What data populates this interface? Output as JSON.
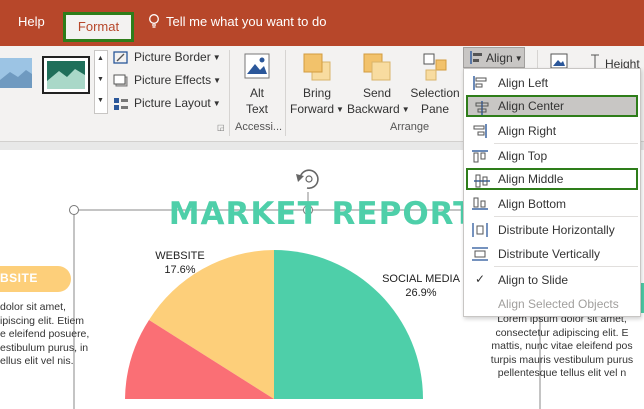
{
  "tabs": {
    "help": "Help",
    "format": "Format",
    "tell_me": "Tell me what you want to do"
  },
  "ribbon": {
    "picture_border": "Picture Border",
    "picture_effects": "Picture Effects",
    "picture_layout": "Picture Layout",
    "alt_text_1": "Alt",
    "alt_text_2": "Text",
    "accessibility_group": "Accessi...",
    "bring_forward_1": "Bring",
    "bring_forward_2": "Forward",
    "send_backward_1": "Send",
    "send_backward_2": "Backward",
    "selection_pane_1": "Selection",
    "selection_pane_2": "Pane",
    "arrange_group": "Arrange",
    "align_button": "Align",
    "height_label": "Height"
  },
  "align_menu": {
    "items": [
      {
        "label": "Align Left",
        "icon": "align-left-icon"
      },
      {
        "label": "Align Center",
        "icon": "align-center-icon",
        "state": "highlighted"
      },
      {
        "label": "Align Right",
        "icon": "align-right-icon"
      },
      {
        "label": "Align Top",
        "icon": "align-top-icon"
      },
      {
        "label": "Align Middle",
        "icon": "align-middle-icon",
        "state": "outlined"
      },
      {
        "label": "Align Bottom",
        "icon": "align-bottom-icon"
      },
      {
        "label": "Distribute Horizontally",
        "icon": "distribute-horizontally-icon"
      },
      {
        "label": "Distribute Vertically",
        "icon": "distribute-vertically-icon"
      },
      {
        "label": "Align to Slide",
        "icon": "checkmark-icon",
        "checked": true
      },
      {
        "label": "Align Selected Objects",
        "disabled": true
      }
    ]
  },
  "slide": {
    "title": "MARKET REPORT",
    "website_label": "WEBSITE",
    "website_pct": "17.6%",
    "social_label": "SOCIAL MEDIA",
    "social_pct": "26.9%",
    "badge_text": "BSITE",
    "left_text": [
      "dolor sit amet,",
      "ipiscing elit. Etiem",
      "e eleifend posuere,",
      "estibulum purus, in",
      "ellus elit vel nis."
    ],
    "right_text": [
      "Lorem ipsum dolor sit amet,",
      "consectetur adipiscing elit. E",
      "mattis, nunc vitae eleifend pos",
      "turpis mauris vestibulum purus",
      "pellentesque tellus elit vel n"
    ]
  },
  "colors": {
    "ribbon_red": "#b7472a",
    "teal": "#4ecfa9",
    "yellow": "#fdcf7a",
    "pink": "#fa6f75",
    "highlight_green": "#2e7d1a"
  }
}
